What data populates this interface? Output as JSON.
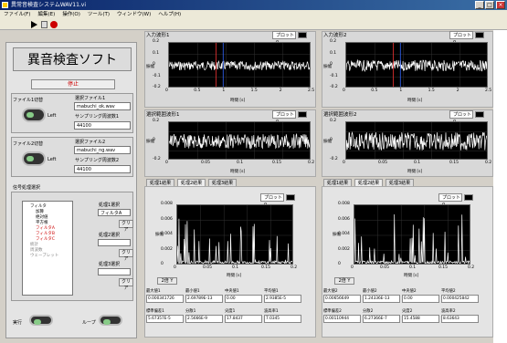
{
  "window": {
    "title": "異常音検査システムWAV11.vi",
    "min": "_",
    "max": "□",
    "close": "×"
  },
  "menu": [
    "ファイル(F)",
    "編集(E)",
    "操作(O)",
    "ツール(T)",
    "ウィンドウ(W)",
    "ヘルプ(H)"
  ],
  "app": {
    "title": "異音検査ソフト",
    "stop_label": "停止"
  },
  "file1": {
    "group_label": "ファイル1切替",
    "toggle_label": "Left",
    "name_label": "選択ファイル1",
    "name_value": "mabuchi_ok.wav",
    "rate_label": "サンプリング周波数1",
    "rate_value": "44100"
  },
  "file2": {
    "group_label": "ファイル2切替",
    "toggle_label": "Left",
    "name_label": "選択ファイル2",
    "name_value": "mabuchi_ng.wav",
    "rate_label": "サンプリング周波数2",
    "rate_value": "44100"
  },
  "processing": {
    "label": "信号処理選択",
    "tree": [
      "フィルタ",
      "加算",
      "絶対値",
      "平方根",
      "フィルタA",
      "フィルタB",
      "フィルタC",
      "統計",
      "周波数",
      "ウェーブレット"
    ],
    "sel1_label": "処理1選択",
    "sel1_value": "フィルタA",
    "clear1": "クリア",
    "sel2_label": "処理2選択",
    "clear2": "クリア",
    "sel3_label": "処理3選択",
    "clear3": "クリア"
  },
  "bottom": {
    "exec_label": "実行",
    "loop_label": "ループ"
  },
  "plots": {
    "in1": {
      "title": "入力波形1",
      "legend": "プロット0",
      "ylabel": "振幅",
      "xlabel": "時間 [s]",
      "xticks": [
        "0",
        "0.5",
        "1",
        "1.5",
        "2",
        "2.5"
      ],
      "yticks": [
        "0.2",
        "0.1",
        "0",
        "-0.1",
        "-0.2"
      ]
    },
    "in2": {
      "title": "入力波形2",
      "legend": "プロット0",
      "ylabel": "振幅",
      "xlabel": "時間 [s]",
      "xticks": [
        "0",
        "0.5",
        "1",
        "1.5",
        "2",
        "2.5"
      ],
      "yticks": [
        "0.2",
        "0.1",
        "0",
        "-0.1",
        "-0.2"
      ]
    },
    "sel1": {
      "title": "選択範囲波形1",
      "legend": "プロット0",
      "ylabel": "振幅",
      "xlabel": "時間 [s]",
      "xticks": [
        "0",
        "0.05",
        "0.1",
        "0.15",
        "0.2"
      ],
      "yticks": [
        "0.2",
        "0",
        "-0.2"
      ]
    },
    "sel2": {
      "title": "選択範囲波形2",
      "legend": "プロット0",
      "ylabel": "振幅",
      "xlabel": "時間 [s]",
      "xticks": [
        "0",
        "0.05",
        "0.1",
        "0.15",
        "0.2"
      ],
      "yticks": [
        "0.2",
        "0",
        "-0.2"
      ]
    }
  },
  "tabs": [
    "処理1結果",
    "処理2結果",
    "処理3結果"
  ],
  "res1": {
    "legend": "プロット0",
    "ylabel": "振幅",
    "xlabel": "時間 [s]",
    "xticks": [
      "0",
      "0.05",
      "0.1",
      "0.15",
      "0.2"
    ],
    "yticks": [
      "0.008",
      "0.006",
      "0.004",
      "0.002",
      "0"
    ],
    "stats_row1_labels": [
      "最大値1",
      "最小値1",
      "中央値1",
      "平均値1"
    ],
    "stats_row1_values": [
      "0.000341726",
      "2.69789E-13",
      "0.00",
      "2.9385E-5"
    ],
    "stats_row2_labels": [
      "標準偏差1",
      "分散1",
      "尖度1",
      "波高率1"
    ],
    "stats_row2_values": [
      "5.67357E-5",
      "2.5666E-9",
      "17.8437",
      "7.0345"
    ]
  },
  "res2": {
    "legend": "プロット0",
    "ylabel": "振幅",
    "xlabel": "時間 [s]",
    "xticks": [
      "0",
      "0.05",
      "0.1",
      "0.15",
      "0.2"
    ],
    "yticks": [
      "0.008",
      "0.006",
      "0.004",
      "0.002",
      "0"
    ],
    "stats_row1_labels": [
      "最大値2",
      "最小値2",
      "中央値2",
      "平均値2"
    ],
    "stats_row1_values": [
      "0.00656649",
      "1.24336E-13",
      "0.00",
      "0.000425842"
    ],
    "stats_row2_labels": [
      "標準偏差2",
      "分散2",
      "尖度2",
      "波高率2"
    ],
    "stats_row2_values": [
      "0.00110944",
      "6.27366E-7",
      "15.4588",
      "8.63643"
    ]
  },
  "zoom_label": "2倍 Y"
}
